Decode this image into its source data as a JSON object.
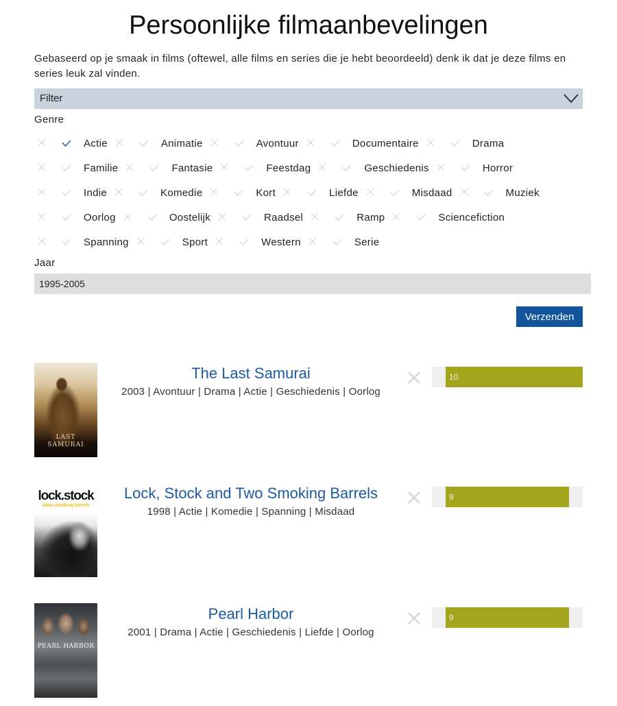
{
  "page": {
    "title": "Persoonlijke filmaanbevelingen",
    "intro": "Gebaseerd op je smaak in films (oftewel, alle films en series die je hebt beoordeeld) denk ik dat je deze films en series leuk zal vinden."
  },
  "filter": {
    "label": "Filter",
    "toggle_icon": "chevron-down-icon",
    "genre_label": "Genre",
    "genres": [
      {
        "label": "Actie",
        "state": "include"
      },
      {
        "label": "Animatie",
        "state": "none"
      },
      {
        "label": "Avontuur",
        "state": "none"
      },
      {
        "label": "Documentaire",
        "state": "none"
      },
      {
        "label": "Drama",
        "state": "none"
      },
      {
        "label": "Familie",
        "state": "none"
      },
      {
        "label": "Fantasie",
        "state": "none"
      },
      {
        "label": "Feestdag",
        "state": "none"
      },
      {
        "label": "Geschiedenis",
        "state": "none"
      },
      {
        "label": "Horror",
        "state": "none"
      },
      {
        "label": "Indie",
        "state": "none"
      },
      {
        "label": "Komedie",
        "state": "none"
      },
      {
        "label": "Kort",
        "state": "none"
      },
      {
        "label": "Liefde",
        "state": "none"
      },
      {
        "label": "Misdaad",
        "state": "none"
      },
      {
        "label": "Muziek",
        "state": "none"
      },
      {
        "label": "Oorlog",
        "state": "none"
      },
      {
        "label": "Oostelijk",
        "state": "none"
      },
      {
        "label": "Raadsel",
        "state": "none"
      },
      {
        "label": "Ramp",
        "state": "none"
      },
      {
        "label": "Sciencefiction",
        "state": "none"
      },
      {
        "label": "Spanning",
        "state": "none"
      },
      {
        "label": "Sport",
        "state": "none"
      },
      {
        "label": "Western",
        "state": "none"
      },
      {
        "label": "Serie",
        "state": "none"
      }
    ],
    "year_label": "Jaar",
    "year_value": "1995-2005",
    "submit_label": "Verzenden"
  },
  "colors": {
    "filter_bar": "#c9d3de",
    "accent_blue": "#12549c",
    "title_link": "#1b5ba5",
    "check_selected": "#2d5f9e",
    "rating_fill": "#a3a51c",
    "rating_track": "#eeeeee"
  },
  "meta_separator": " | ",
  "movies": [
    {
      "title": "The Last Samurai",
      "year": "2003",
      "genres": [
        "Avontuur",
        "Drama",
        "Actie",
        "Geschiedenis",
        "Oorlog"
      ],
      "score": 10,
      "score_max": 10,
      "poster_text": "LAST\nSAMURAI"
    },
    {
      "title": "Lock, Stock and Two Smoking Barrels",
      "year": "1998",
      "genres": [
        "Actie",
        "Komedie",
        "Spanning",
        "Misdaad"
      ],
      "score": 9,
      "score_max": 10,
      "poster_text": "lock.stock",
      "poster_subtext": "&two smoking barrels"
    },
    {
      "title": "Pearl Harbor",
      "year": "2001",
      "genres": [
        "Drama",
        "Actie",
        "Geschiedenis",
        "Liefde",
        "Oorlog"
      ],
      "score": 9,
      "score_max": 10,
      "poster_text": "PEARL HARBOR"
    }
  ]
}
